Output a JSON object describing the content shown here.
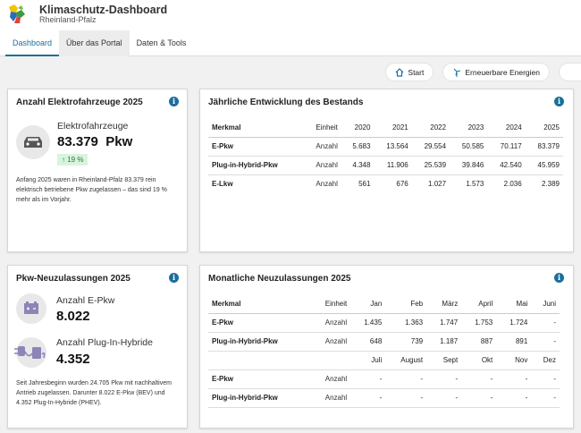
{
  "app": {
    "title": "Klimaschutz-Dashboard",
    "subtitle": "Rheinland-Pfalz"
  },
  "nav": {
    "tabs": [
      {
        "label": "Dashboard"
      },
      {
        "label": "Über das Portal"
      },
      {
        "label": "Daten & Tools"
      }
    ]
  },
  "toolbar": {
    "start_label": "Start",
    "renewable_label": "Erneuerbare Energien"
  },
  "card1": {
    "title": "Anzahl Elektrofahrzeuge 2025",
    "label": "Elektrofahrzeuge",
    "value": "83.379",
    "unit": "Pkw",
    "badge": "19 %",
    "description": "Anfang 2025 waren in Rheinland-Pfalz 83.379 rein elektrisch betriebene Pkw zugelassen – das sind 19 % mehr als im Vorjahr."
  },
  "card2": {
    "title": "Jährliche Entwicklung des Bestands",
    "headers": [
      "Merkmal",
      "Einheit",
      "2020",
      "2021",
      "2022",
      "2023",
      "2024",
      "2025"
    ],
    "rows": [
      {
        "label": "E-Pkw",
        "unit": "Anzahl",
        "values": [
          "5.683",
          "13.564",
          "29.554",
          "50.585",
          "70.117",
          "83.379"
        ]
      },
      {
        "label": "Plug-in-Hybrid-Pkw",
        "unit": "Anzahl",
        "values": [
          "4.348",
          "11.906",
          "25.539",
          "39.846",
          "42.540",
          "45.959"
        ]
      },
      {
        "label": "E-Lkw",
        "unit": "Anzahl",
        "values": [
          "561",
          "676",
          "1.027",
          "1.573",
          "2.036",
          "2.389"
        ]
      }
    ]
  },
  "card3": {
    "title": "Pkw-Neuzulassungen 2025",
    "item1_label": "Anzahl E-Pkw",
    "item1_value": "8.022",
    "item2_label": "Anzahl Plug-In-Hybride",
    "item2_value": "4.352",
    "description": "Seit Jahresbeginn wurden 24.705 Pkw mit nachhaltivem Antrieb zugelassen. Darunter 8.022 E-Pkw (BEV) und 4.352 Plug-In-Hybride (PHEV)."
  },
  "card4": {
    "title": "Monatliche Neuzulassungen 2025",
    "headers1": [
      "Merkmal",
      "Einheit",
      "Jan",
      "Feb",
      "März",
      "April",
      "Mai",
      "Juni"
    ],
    "rows1": [
      {
        "label": "E-Pkw",
        "unit": "Anzahl",
        "values": [
          "1.435",
          "1.363",
          "1.747",
          "1.753",
          "1.724",
          "-"
        ]
      },
      {
        "label": "Plug-in-Hybrid-Pkw",
        "unit": "Anzahl",
        "values": [
          "648",
          "739",
          "1.187",
          "887",
          "891",
          "-"
        ]
      }
    ],
    "headers2": [
      "Juli",
      "August",
      "Sept",
      "Okt",
      "Nov",
      "Dez"
    ],
    "rows2": [
      {
        "label": "E-Pkw",
        "unit": "Anzahl",
        "values": [
          "-",
          "-",
          "-",
          "-",
          "-",
          "-"
        ]
      },
      {
        "label": "Plug-in-Hybrid-Pkw",
        "unit": "Anzahl",
        "values": [
          "-",
          "-",
          "-",
          "-",
          "-",
          "-"
        ]
      }
    ]
  },
  "colors": {
    "accent": "#1b6f9c",
    "badge_bg": "#d9f3dc",
    "badge_text": "#227a3a",
    "icon_purple": "#8e84b8"
  },
  "icons": {
    "logo": "rlp-logo",
    "home": "home-icon",
    "wind": "wind-turbine-icon",
    "info": "info-icon",
    "car": "electric-car-icon",
    "arrow": "arrow-up-icon",
    "battery": "battery-icon",
    "plug": "plug-icon"
  }
}
